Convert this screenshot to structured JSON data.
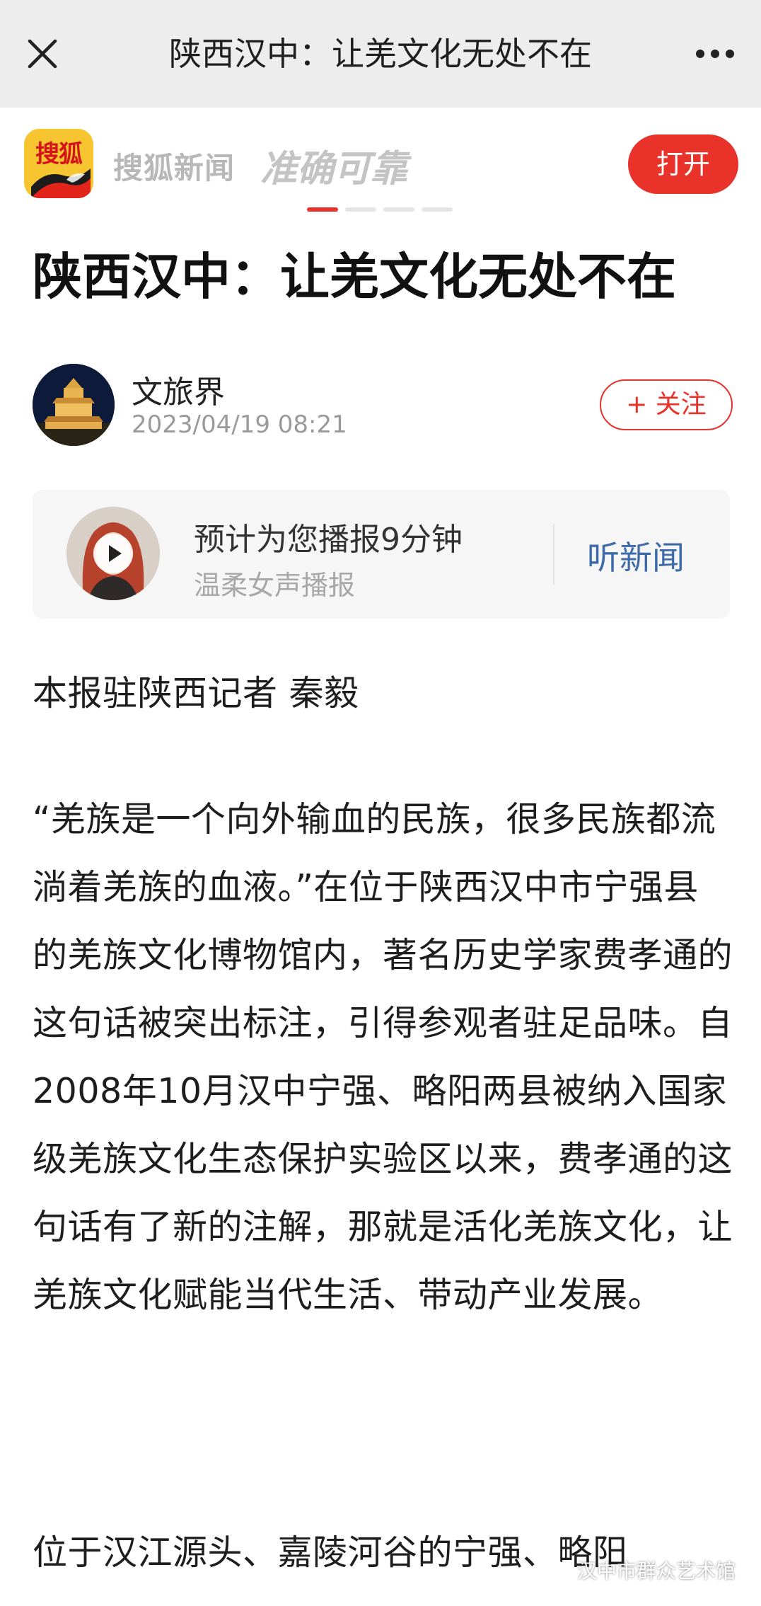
{
  "navbar": {
    "title": "陕西汉中：让羌文化无处不在",
    "close_icon": "close-icon",
    "more_icon": "more-icon"
  },
  "banner": {
    "logo_text": "搜狐",
    "brand_name": "搜狐新闻",
    "slogan": "准确可靠",
    "open_label": "打开",
    "accent_color": "#e8322a"
  },
  "article": {
    "title": "陕西汉中：让羌文化无处不在",
    "author": {
      "name": "文旅界",
      "time": "2023/04/19 08:21",
      "follow_label": "+ 关注"
    },
    "audio": {
      "headline": "预计为您播报9分钟",
      "voice": "温柔女声播报",
      "listen_label": "听新闻",
      "play_icon": "play-icon"
    },
    "paragraphs": {
      "byline": "本报驻陕西记者 秦毅",
      "main": "“羌族是一个向外输血的民族，很多民族都流淌着羌族的血液。”在位于陕西汉中市宁强县的羌族文化博物馆内，著名历史学家费孝通的这句话被突出标注，引得参观者驻足品味。自2008年10月汉中宁强、略阳两县被纳入国家级羌族文化生态保护实验区以来，费孝通的这句话有了新的注解，那就是活化羌族文化，让羌族文化赋能当代生活、带动产业发展。",
      "next": "位于汉江源头、嘉陵河谷的宁强、略阳"
    }
  },
  "watermark": {
    "text": "汉中市群众艺术馆",
    "icon": "wechat-icon"
  }
}
